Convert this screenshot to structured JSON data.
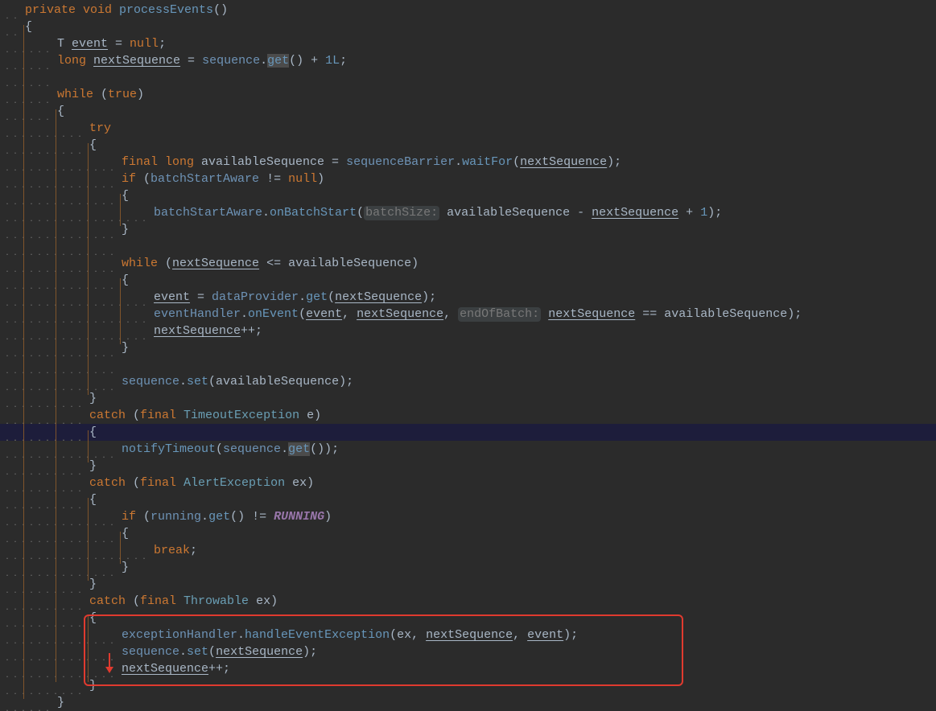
{
  "editor": {
    "language": "java",
    "theme": "dark",
    "caret_line": 26,
    "annotation": {
      "shape": "red-rounded-rectangle",
      "color": "#e03a2f",
      "covers_lines": [
        36,
        40
      ]
    },
    "lines": [
      [
        {
          "t": "private ",
          "c": "kw"
        },
        {
          "t": "void ",
          "c": "kw"
        },
        {
          "t": "processEvents",
          "c": "fn"
        },
        {
          "t": "()"
        }
      ],
      [
        {
          "t": "{"
        }
      ],
      [
        {
          "t": "T "
        },
        {
          "t": "event",
          "c": "ul"
        },
        {
          "t": " = "
        },
        {
          "t": "null",
          "c": "kw"
        },
        {
          "t": ";"
        }
      ],
      [
        {
          "t": "long ",
          "c": "kw"
        },
        {
          "t": "nextSequence",
          "c": "ul"
        },
        {
          "t": " = "
        },
        {
          "t": "sequence",
          "c": "fld"
        },
        {
          "t": "."
        },
        {
          "t": "get",
          "c": "fn occ"
        },
        {
          "t": "() + "
        },
        {
          "t": "1L",
          "c": "num"
        },
        {
          "t": ";"
        }
      ],
      [],
      [
        {
          "t": "while ",
          "c": "kw"
        },
        {
          "t": "("
        },
        {
          "t": "true",
          "c": "kw"
        },
        {
          "t": ")"
        }
      ],
      [
        {
          "t": "{"
        }
      ],
      [
        {
          "t": "try",
          "c": "kw"
        }
      ],
      [
        {
          "t": "{"
        }
      ],
      [
        {
          "t": "final ",
          "c": "kw"
        },
        {
          "t": "long ",
          "c": "kw"
        },
        {
          "t": "availableSequence = "
        },
        {
          "t": "sequenceBarrier",
          "c": "fld"
        },
        {
          "t": "."
        },
        {
          "t": "waitFor",
          "c": "fn"
        },
        {
          "t": "("
        },
        {
          "t": "nextSequence",
          "c": "ul"
        },
        {
          "t": ");"
        }
      ],
      [
        {
          "t": "if ",
          "c": "kw"
        },
        {
          "t": "("
        },
        {
          "t": "batchStartAware",
          "c": "fld"
        },
        {
          "t": " != "
        },
        {
          "t": "null",
          "c": "kw"
        },
        {
          "t": ")"
        }
      ],
      [
        {
          "t": "{"
        }
      ],
      [
        {
          "t": "batchStartAware",
          "c": "fld"
        },
        {
          "t": "."
        },
        {
          "t": "onBatchStart",
          "c": "fn"
        },
        {
          "t": "("
        },
        {
          "t": "batchSize:",
          "c": "hint"
        },
        {
          "t": " availableSequence - "
        },
        {
          "t": "nextSequence",
          "c": "ul"
        },
        {
          "t": " + "
        },
        {
          "t": "1",
          "c": "num"
        },
        {
          "t": ");"
        }
      ],
      [
        {
          "t": "}"
        }
      ],
      [],
      [
        {
          "t": "while ",
          "c": "kw"
        },
        {
          "t": "("
        },
        {
          "t": "nextSequence",
          "c": "ul"
        },
        {
          "t": " <= availableSequence)"
        }
      ],
      [
        {
          "t": "{"
        }
      ],
      [
        {
          "t": "event",
          "c": "ul"
        },
        {
          "t": " = "
        },
        {
          "t": "dataProvider",
          "c": "fld"
        },
        {
          "t": "."
        },
        {
          "t": "get",
          "c": "fn"
        },
        {
          "t": "("
        },
        {
          "t": "nextSequence",
          "c": "ul"
        },
        {
          "t": ");"
        }
      ],
      [
        {
          "t": "eventHandler",
          "c": "fld"
        },
        {
          "t": "."
        },
        {
          "t": "onEvent",
          "c": "fn"
        },
        {
          "t": "("
        },
        {
          "t": "event",
          "c": "ul"
        },
        {
          "t": ", "
        },
        {
          "t": "nextSequence",
          "c": "ul"
        },
        {
          "t": ", "
        },
        {
          "t": "endOfBatch:",
          "c": "hint"
        },
        {
          "t": " "
        },
        {
          "t": "nextSequence",
          "c": "ul"
        },
        {
          "t": " == availableSequence);"
        }
      ],
      [
        {
          "t": "nextSequence",
          "c": "ul"
        },
        {
          "t": "++;"
        }
      ],
      [
        {
          "t": "}"
        }
      ],
      [],
      [
        {
          "t": "sequence",
          "c": "fld"
        },
        {
          "t": "."
        },
        {
          "t": "set",
          "c": "fn"
        },
        {
          "t": "(availableSequence);"
        }
      ],
      [
        {
          "t": "}"
        }
      ],
      [
        {
          "t": "catch ",
          "c": "kw"
        },
        {
          "t": "("
        },
        {
          "t": "final ",
          "c": "kw"
        },
        {
          "t": "TimeoutException",
          "c": "typ"
        },
        {
          "t": " e)"
        }
      ],
      [
        {
          "t": "{"
        }
      ],
      [
        {
          "t": "notifyTimeout",
          "c": "fn"
        },
        {
          "t": "("
        },
        {
          "t": "sequence",
          "c": "fld"
        },
        {
          "t": "."
        },
        {
          "t": "get",
          "c": "fn occ"
        },
        {
          "t": "());"
        }
      ],
      [
        {
          "t": "}"
        }
      ],
      [
        {
          "t": "catch ",
          "c": "kw"
        },
        {
          "t": "("
        },
        {
          "t": "final ",
          "c": "kw"
        },
        {
          "t": "AlertException",
          "c": "typ"
        },
        {
          "t": " ex)"
        }
      ],
      [
        {
          "t": "{"
        }
      ],
      [
        {
          "t": "if ",
          "c": "kw"
        },
        {
          "t": "("
        },
        {
          "t": "running",
          "c": "fld"
        },
        {
          "t": "."
        },
        {
          "t": "get",
          "c": "fn"
        },
        {
          "t": "() != "
        },
        {
          "t": "RUNNING",
          "c": "cst"
        },
        {
          "t": ")"
        }
      ],
      [
        {
          "t": "{"
        }
      ],
      [
        {
          "t": "break",
          "c": "kw"
        },
        {
          "t": ";"
        }
      ],
      [
        {
          "t": "}"
        }
      ],
      [
        {
          "t": "}"
        }
      ],
      [
        {
          "t": "catch ",
          "c": "kw"
        },
        {
          "t": "("
        },
        {
          "t": "final ",
          "c": "kw"
        },
        {
          "t": "Throwable",
          "c": "typ"
        },
        {
          "t": " ex)"
        }
      ],
      [
        {
          "t": "{"
        }
      ],
      [
        {
          "t": "exceptionHandler",
          "c": "fld"
        },
        {
          "t": "."
        },
        {
          "t": "handleEventException",
          "c": "fn"
        },
        {
          "t": "(ex, "
        },
        {
          "t": "nextSequence",
          "c": "ul"
        },
        {
          "t": ", "
        },
        {
          "t": "event",
          "c": "ul"
        },
        {
          "t": ");"
        }
      ],
      [
        {
          "t": "sequence",
          "c": "fld"
        },
        {
          "t": "."
        },
        {
          "t": "set",
          "c": "fn"
        },
        {
          "t": "("
        },
        {
          "t": "nextSequence",
          "c": "ul"
        },
        {
          "t": ");"
        }
      ],
      [
        {
          "t": "nextSequence",
          "c": "ul"
        },
        {
          "t": "++;"
        }
      ],
      [
        {
          "t": "}"
        }
      ],
      [
        {
          "t": "}"
        }
      ]
    ]
  }
}
